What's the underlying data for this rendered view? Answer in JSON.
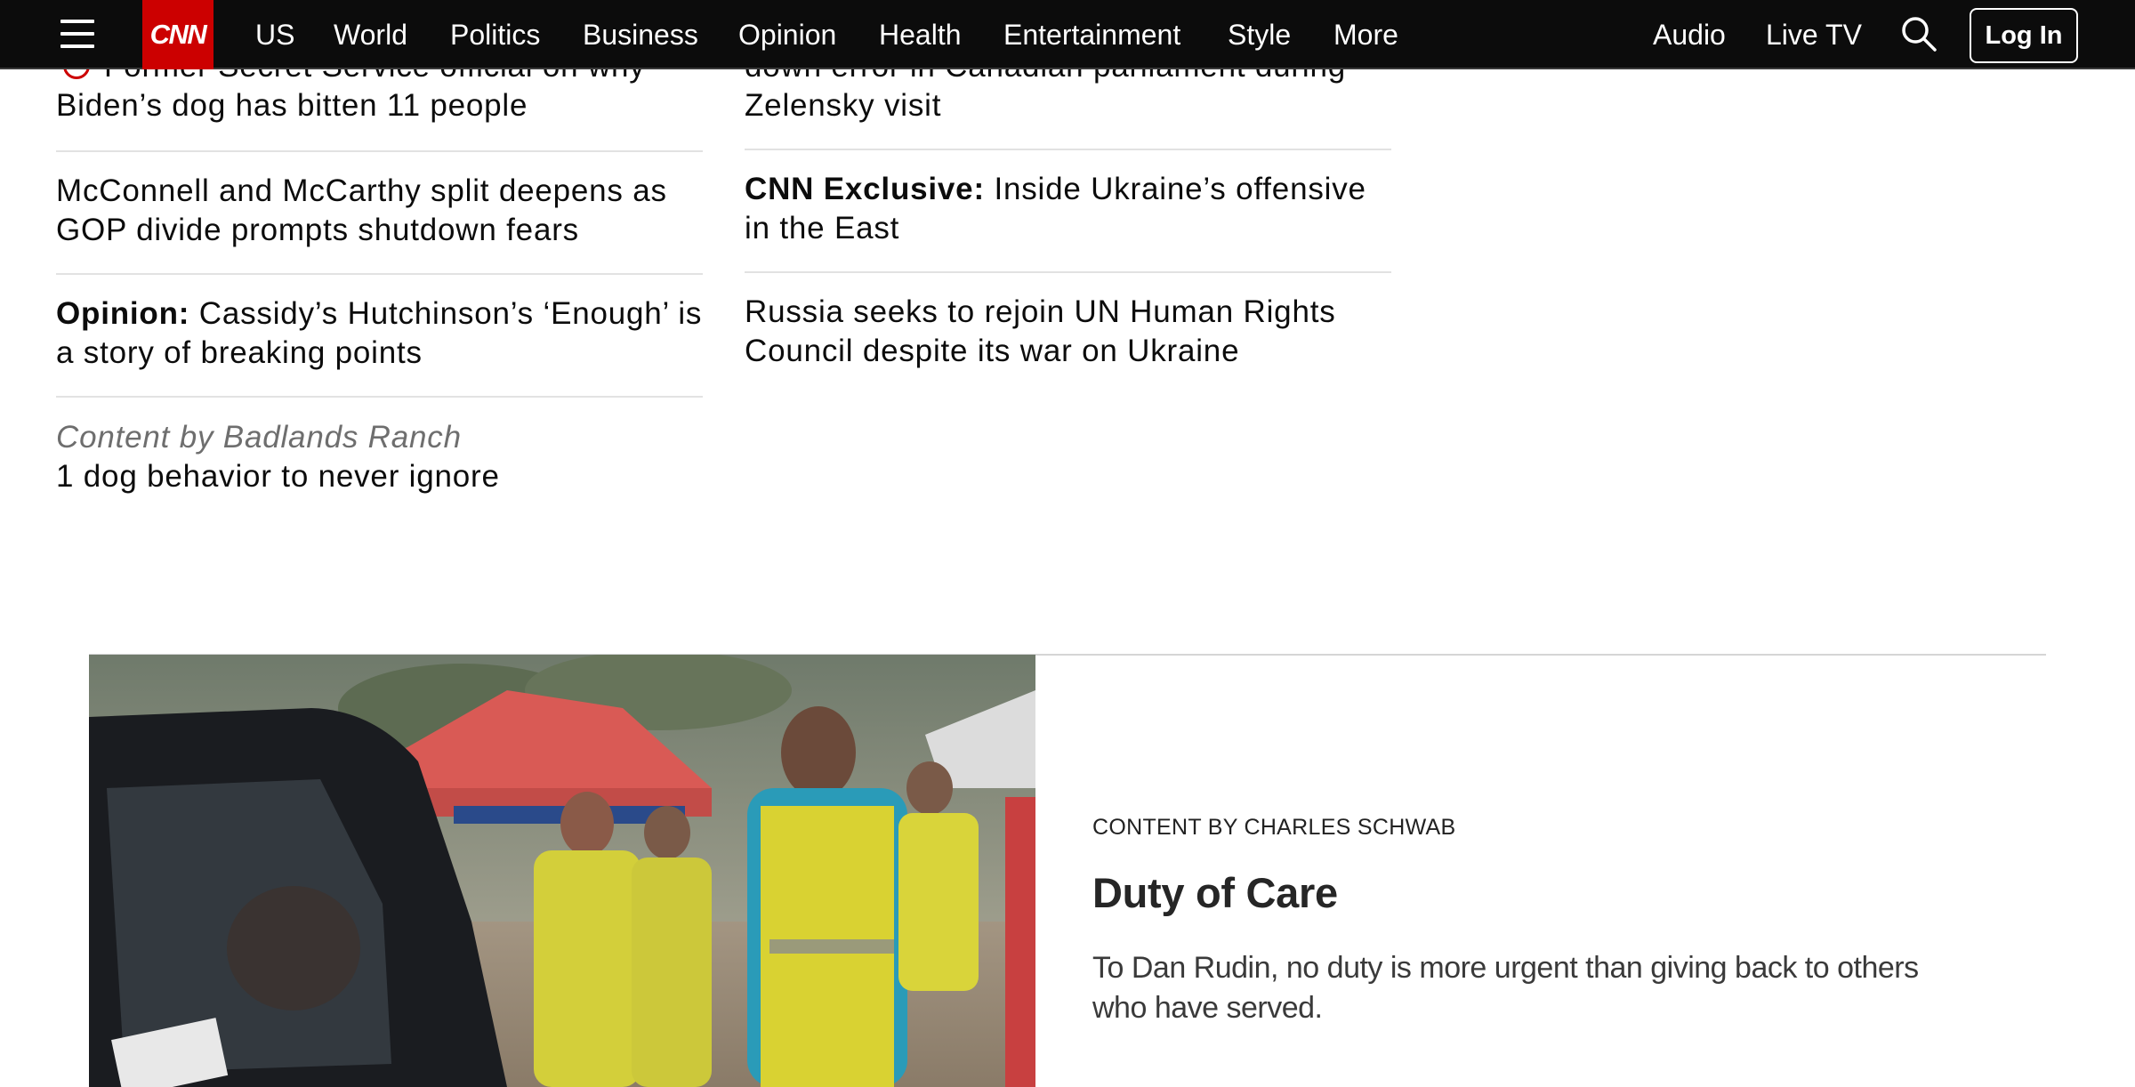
{
  "nav": {
    "logo_text": "CNN",
    "items": [
      "US",
      "World",
      "Politics",
      "Business",
      "Opinion",
      "Health",
      "Entertainment",
      "Style",
      "More"
    ],
    "audio_label": "Audio",
    "live_tv_label": "Live TV",
    "login_label": "Log In",
    "colors": {
      "bar": "#0c0c0c",
      "brand": "#cc0000"
    }
  },
  "left_column": {
    "item1": {
      "line1": "Former Secret Service official on why",
      "line2": "Biden’s dog has bitten 11 people"
    },
    "item2": {
      "text": "McConnell and McCarthy split deepens as GOP divide prompts shutdown fears"
    },
    "item3": {
      "prefix": "Opinion:",
      "text": "Cassidy’s Hutchinson’s ‘Enough’ is a story of breaking points"
    },
    "item4": {
      "sponsor": "Content by Badlands Ranch",
      "text": "1 dog behavior to never ignore"
    }
  },
  "mid_column": {
    "item1": {
      "line1": "down error in Canadian parliament during",
      "line2": "Zelensky visit"
    },
    "item2": {
      "prefix": "CNN Exclusive:",
      "text": "Inside Ukraine’s offensive in the East"
    },
    "item3": {
      "text": "Russia seeks to rejoin UN Human Rights Council despite its war on Ukraine"
    }
  },
  "sponsored_card": {
    "eyebrow": "CONTENT BY CHARLES SCHWAB",
    "title": "Duty of Care",
    "description": "To Dan Rudin, no duty is more urgent than giving back to others who have served."
  }
}
